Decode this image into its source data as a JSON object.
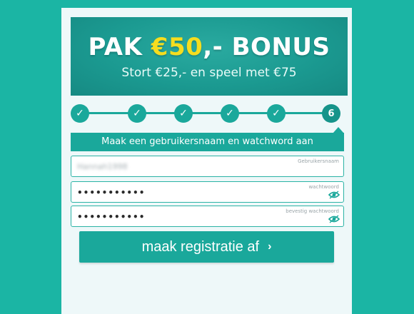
{
  "banner": {
    "title_prefix": "PAK ",
    "title_amount": "€50",
    "title_suffix": ",- BONUS",
    "subtitle": "Stort €25,- en speel met €75"
  },
  "steps": {
    "items": [
      "✓",
      "✓",
      "✓",
      "✓",
      "✓",
      "6"
    ],
    "current_index": 5,
    "label": "Maak een gebruikersnaam en watchword aan"
  },
  "form": {
    "username": {
      "label": "Gebruikersnaam",
      "value": "Hannah1998"
    },
    "password": {
      "label": "wachtwoord",
      "value": "•••••••••••"
    },
    "confirm": {
      "label": "bevestig wachtwoord",
      "value": "•••••••••••"
    }
  },
  "submit": {
    "label": "maak registratie af",
    "chevron": "›"
  },
  "colors": {
    "background": "#1bb5a4",
    "accent": "#1aa89b",
    "highlight": "#f5dd1f"
  },
  "icons": {
    "visibility": "eye-icon",
    "complete": "check-icon",
    "submit": "chevron-right-icon"
  }
}
